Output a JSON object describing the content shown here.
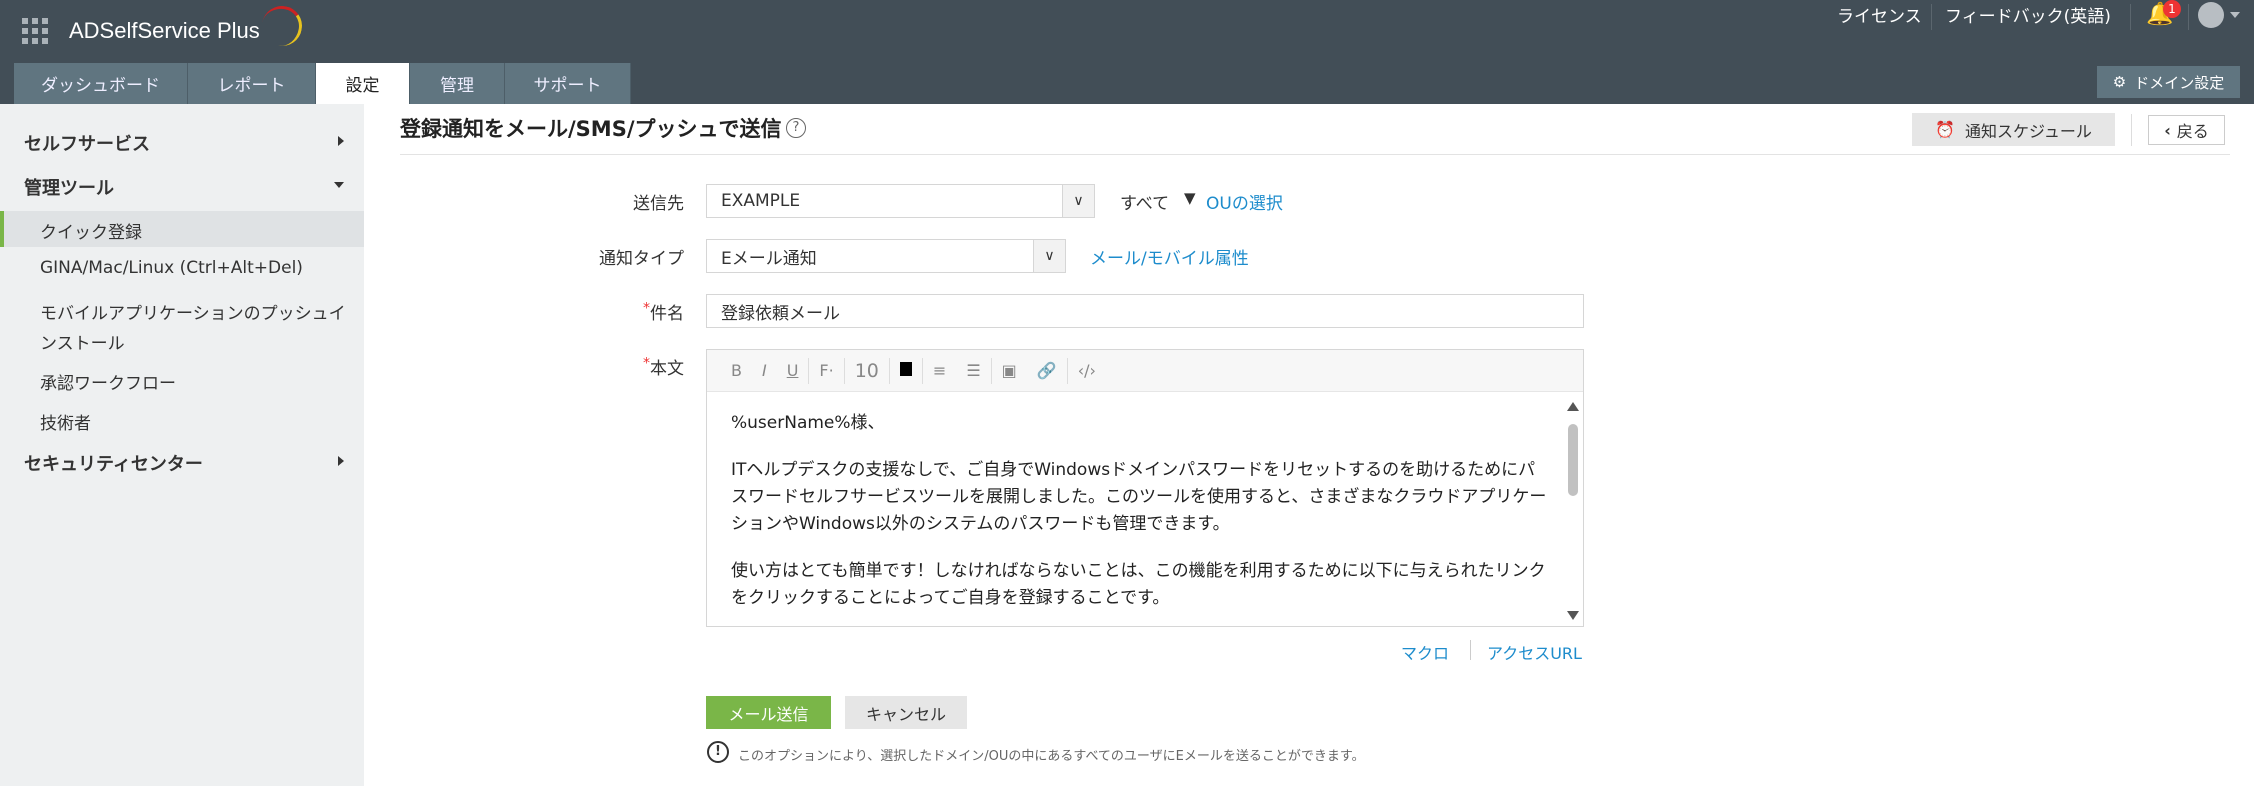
{
  "header": {
    "brand": "ADSelfService Plus",
    "tabs": [
      "ダッシュボード",
      "レポート",
      "設定",
      "管理",
      "サポート"
    ],
    "active_tab": "設定",
    "license": "ライセンス",
    "feedback": "フィードバック(英語)",
    "notification_count": "1",
    "domain_settings": "ドメイン設定"
  },
  "sidebar": {
    "self_service": "セルフサービス",
    "admin_tools": "管理ツール",
    "items": [
      "クイック登録",
      "GINA/Mac/Linux (Ctrl+Alt+Del)",
      "モバイルアプリケーションのプッシュインストール",
      "承認ワークフロー",
      "技術者"
    ],
    "security_center": "セキュリティセンター"
  },
  "page": {
    "title": "登録通知をメール/SMS/プッシュで送信",
    "help": "?",
    "schedule_button": "通知スケジュール",
    "back_button": "戻る"
  },
  "form": {
    "recipient_label": "送信先",
    "recipient_value": "EXAMPLE",
    "recipient_all": "すべて",
    "select_ou": "OUの選択",
    "type_label": "通知タイプ",
    "type_value": "Eメール通知",
    "mail_mobile_attr": "メール/モバイル属性",
    "subject_label": "件名",
    "subject_value": "登録依頼メール",
    "body_label": "本文",
    "required_mark": "*",
    "toolbar": {
      "bold": "B",
      "italic": "I",
      "underline": "U",
      "font": "F·",
      "size": "10"
    },
    "body": [
      "%userName%様、",
      "ITヘルプデスクの支援なしで、ご自身でWindowsドメインパスワードをリセットするのを助けるためにパスワードセルフサービスツールを展開しました。このツールを使用すると、さまざまなクラウドアプリケーションやWindows以外のシステムのパスワードも管理できます。",
      "使い方はとても簡単です！しなければならないことは、この機能を利用するために以下に与えられたリンクをクリックすることによってご自身を登録することです。"
    ],
    "macro": "マクロ",
    "access_url": "アクセスURL",
    "send_button": "メール送信",
    "cancel_button": "キャンセル",
    "note": "このオプションにより、選択したドメイン/OUの中にあるすべてのユーザにEメールを送ることができます。"
  }
}
